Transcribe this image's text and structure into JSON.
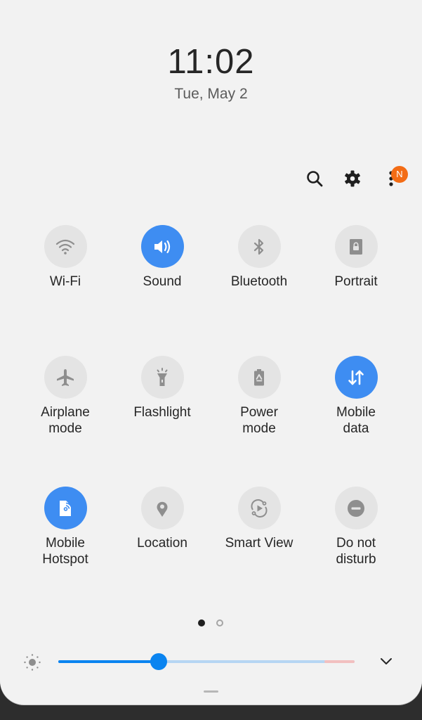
{
  "header": {
    "time": "11:02",
    "date": "Tue, May 2"
  },
  "toolbar": {
    "search_icon": "search-icon",
    "settings_icon": "gear-icon",
    "more_icon": "more-vertical-icon",
    "notification_badge": "N",
    "badge_color": "#f36c15"
  },
  "colors": {
    "active_tile": "#3e8df2",
    "inactive_tile": "#e4e4e4",
    "slider_active": "#0a84f0",
    "slider_track": "#b6d6f3",
    "slider_warning": "#f2c0c0"
  },
  "tiles": [
    {
      "label": "Wi-Fi",
      "icon": "wifi-icon",
      "active": false
    },
    {
      "label": "Sound",
      "icon": "sound-icon",
      "active": true
    },
    {
      "label": "Bluetooth",
      "icon": "bluetooth-icon",
      "active": false
    },
    {
      "label": "Portrait",
      "icon": "rotation-lock-icon",
      "active": false
    },
    {
      "label": "Airplane\nmode",
      "icon": "airplane-icon",
      "active": false
    },
    {
      "label": "Flashlight",
      "icon": "flashlight-icon",
      "active": false
    },
    {
      "label": "Power\nmode",
      "icon": "battery-recycle-icon",
      "active": false
    },
    {
      "label": "Mobile\ndata",
      "icon": "data-arrows-icon",
      "active": true
    },
    {
      "label": "Mobile\nHotspot",
      "icon": "hotspot-icon",
      "active": true
    },
    {
      "label": "Location",
      "icon": "location-pin-icon",
      "active": false
    },
    {
      "label": "Smart View",
      "icon": "smart-view-icon",
      "active": false
    },
    {
      "label": "Do not\ndisturb",
      "icon": "do-not-disturb-icon",
      "active": false
    }
  ],
  "pagination": {
    "current_page": 1,
    "total_pages": 2
  },
  "brightness": {
    "icon": "brightness-icon",
    "level_fraction": 0.34,
    "warning_from_fraction": 0.899,
    "expand_icon": "chevron-down-icon"
  }
}
